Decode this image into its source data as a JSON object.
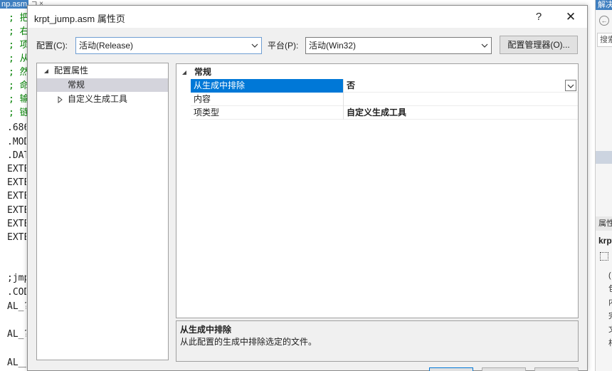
{
  "editor": {
    "tab_label": "np.asm",
    "tab_pin": "⊐ ×",
    "lines": [
      {
        "text": "; 把",
        "kind": "comment"
      },
      {
        "text": "; 右",
        "kind": "comment"
      },
      {
        "text": "; 项",
        "kind": "comment"
      },
      {
        "text": "; 从",
        "kind": "comment"
      },
      {
        "text": "; 然",
        "kind": "comment"
      },
      {
        "text": "; 命",
        "kind": "comment"
      },
      {
        "text": "; 输",
        "kind": "comment"
      },
      {
        "text": "; 链",
        "kind": "comment"
      },
      {
        "text": ".686",
        "kind": "normal"
      },
      {
        "text": ".MODEL",
        "kind": "normal"
      },
      {
        "text": ".DATA",
        "kind": "normal"
      },
      {
        "text": "EXTERN",
        "kind": "normal"
      },
      {
        "text": "EXTERN",
        "kind": "normal"
      },
      {
        "text": "EXTERN",
        "kind": "normal"
      },
      {
        "text": "EXTERN",
        "kind": "normal"
      },
      {
        "text": "EXTERN",
        "kind": "normal"
      },
      {
        "text": "EXTERN",
        "kind": "normal"
      },
      {
        "text": "",
        "kind": "normal"
      },
      {
        "text": "",
        "kind": "normal"
      },
      {
        "text": ";jmp",
        "kind": "normal"
      },
      {
        "text": ".CODE",
        "kind": "normal"
      },
      {
        "text": "AL_?",
        "kind": "normal"
      },
      {
        "text": "",
        "kind": "normal"
      },
      {
        "text": "AL_?",
        "kind": "normal"
      },
      {
        "text": "",
        "kind": "normal"
      },
      {
        "text": "AL__",
        "kind": "normal"
      }
    ]
  },
  "right_panel": {
    "solution_tab": "解决",
    "search_placeholder": "搜索",
    "properties_tab": "属性",
    "properties_file": "krpt",
    "chars": [
      "(",
      "包",
      "内",
      "完",
      "文",
      "相"
    ]
  },
  "dialog": {
    "title": "krpt_jump.asm 属性页",
    "help_label": "?",
    "close_label": "✕",
    "config_label": "配置(C):",
    "config_value": "活动(Release)",
    "platform_label": "平台(P):",
    "platform_value": "活动(Win32)",
    "config_manager_label": "配置管理器(O)...",
    "tree": {
      "root_label": "配置属性",
      "general_label": "常规",
      "custom_build_label": "自定义生成工具"
    },
    "grid": {
      "category_label": "常规",
      "rows": [
        {
          "name": "从生成中排除",
          "value": "否"
        },
        {
          "name": "内容",
          "value": ""
        },
        {
          "name": "项类型",
          "value": "自定义生成工具"
        }
      ]
    },
    "description": {
      "title": "从生成中排除",
      "text": "从此配置的生成中排除选定的文件。"
    }
  },
  "colors": {
    "selection_blue": "#0078d7",
    "comment_green": "#008000",
    "editor_tab_blue": "#3f7fc0"
  }
}
